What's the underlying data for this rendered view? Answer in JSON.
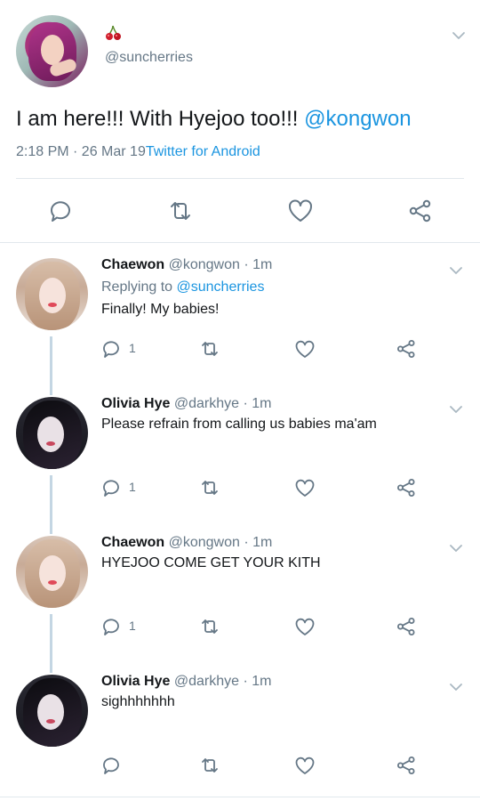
{
  "main_tweet": {
    "display_name_emoji": "🍒",
    "handle": "@suncherries",
    "text": "I am here!!! With Hyejoo too!!! ",
    "mention": "@kongwon",
    "timestamp": "2:18 PM · 26 Mar 19",
    "client": "Twitter for Android",
    "actions": [
      "reply-icon",
      "retweet-icon",
      "like-icon",
      "share-icon"
    ]
  },
  "replies": [
    {
      "name": "Chaewon",
      "handle_time": "@kongwon · 1m",
      "replying_prefix": "Replying to ",
      "replying_to": "@suncherries",
      "text": "Finally! My babies!",
      "reply_count": "1"
    },
    {
      "name": "Olivia Hye",
      "handle_time": "@darkhye · 1m",
      "text": "Please refrain from calling us babies ma'am",
      "reply_count": "1"
    },
    {
      "name": "Chaewon",
      "handle_time": "@kongwon · 1m",
      "text": "HYEJOO COME GET YOUR KITH",
      "reply_count": "1"
    },
    {
      "name": "Olivia Hye",
      "handle_time": "@darkhye · 1m",
      "text": "sighhhhhhh",
      "reply_count": ""
    }
  ],
  "colors": {
    "link": "#1b95e0",
    "secondary_text": "#657786",
    "divider": "#e1e8ed",
    "icon": "#657786",
    "thread_line": "#c4d6e3"
  }
}
